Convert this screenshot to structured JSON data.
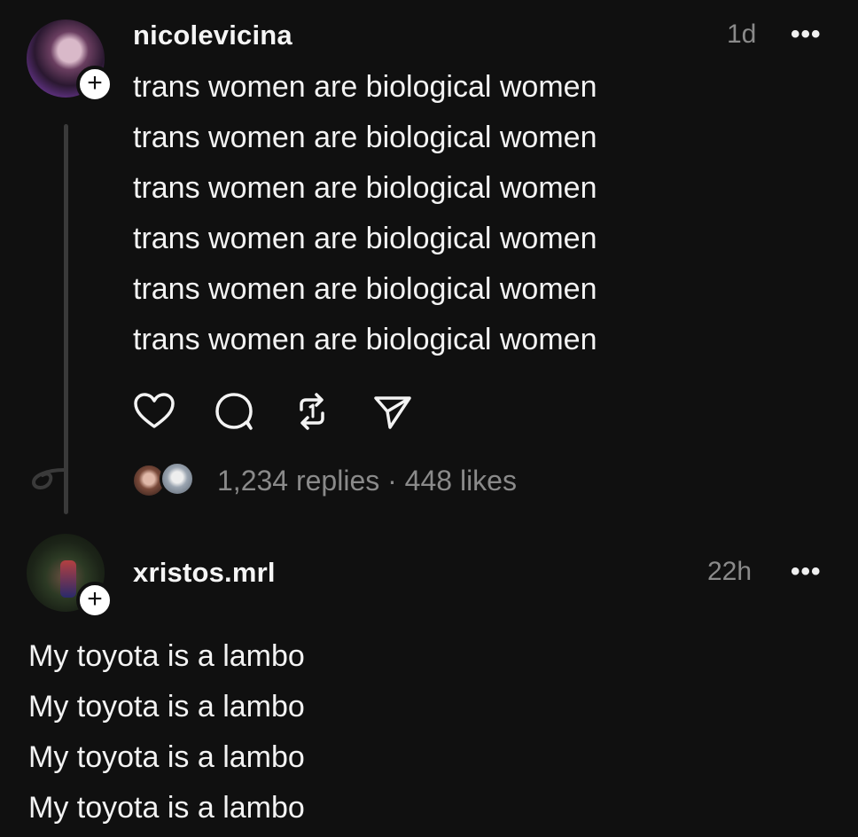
{
  "post1": {
    "username": "nicolevicina",
    "time": "1d",
    "more": "•••",
    "lines": [
      "trans women are biological women",
      "trans women are biological women",
      "trans women are biological women",
      "trans women are biological women",
      "trans women are biological women",
      "trans women are biological women"
    ],
    "follow_symbol": "+",
    "actions": [
      "heart-icon",
      "comment-icon",
      "repost-icon",
      "share-icon"
    ],
    "replies": "1,234 replies",
    "separator": " · ",
    "likes": "448 likes"
  },
  "post2": {
    "username": "xristos.mrl",
    "time": "22h",
    "more": "•••",
    "follow_symbol": "+",
    "lines": [
      "My toyota is a lambo",
      "My toyota is a lambo",
      "My toyota is a lambo",
      "My toyota is a lambo"
    ]
  },
  "colors": {
    "background": "#101010",
    "text": "#f3f3f3",
    "secondary": "#8a8a8a",
    "thread_line": "#3a3a3a"
  }
}
